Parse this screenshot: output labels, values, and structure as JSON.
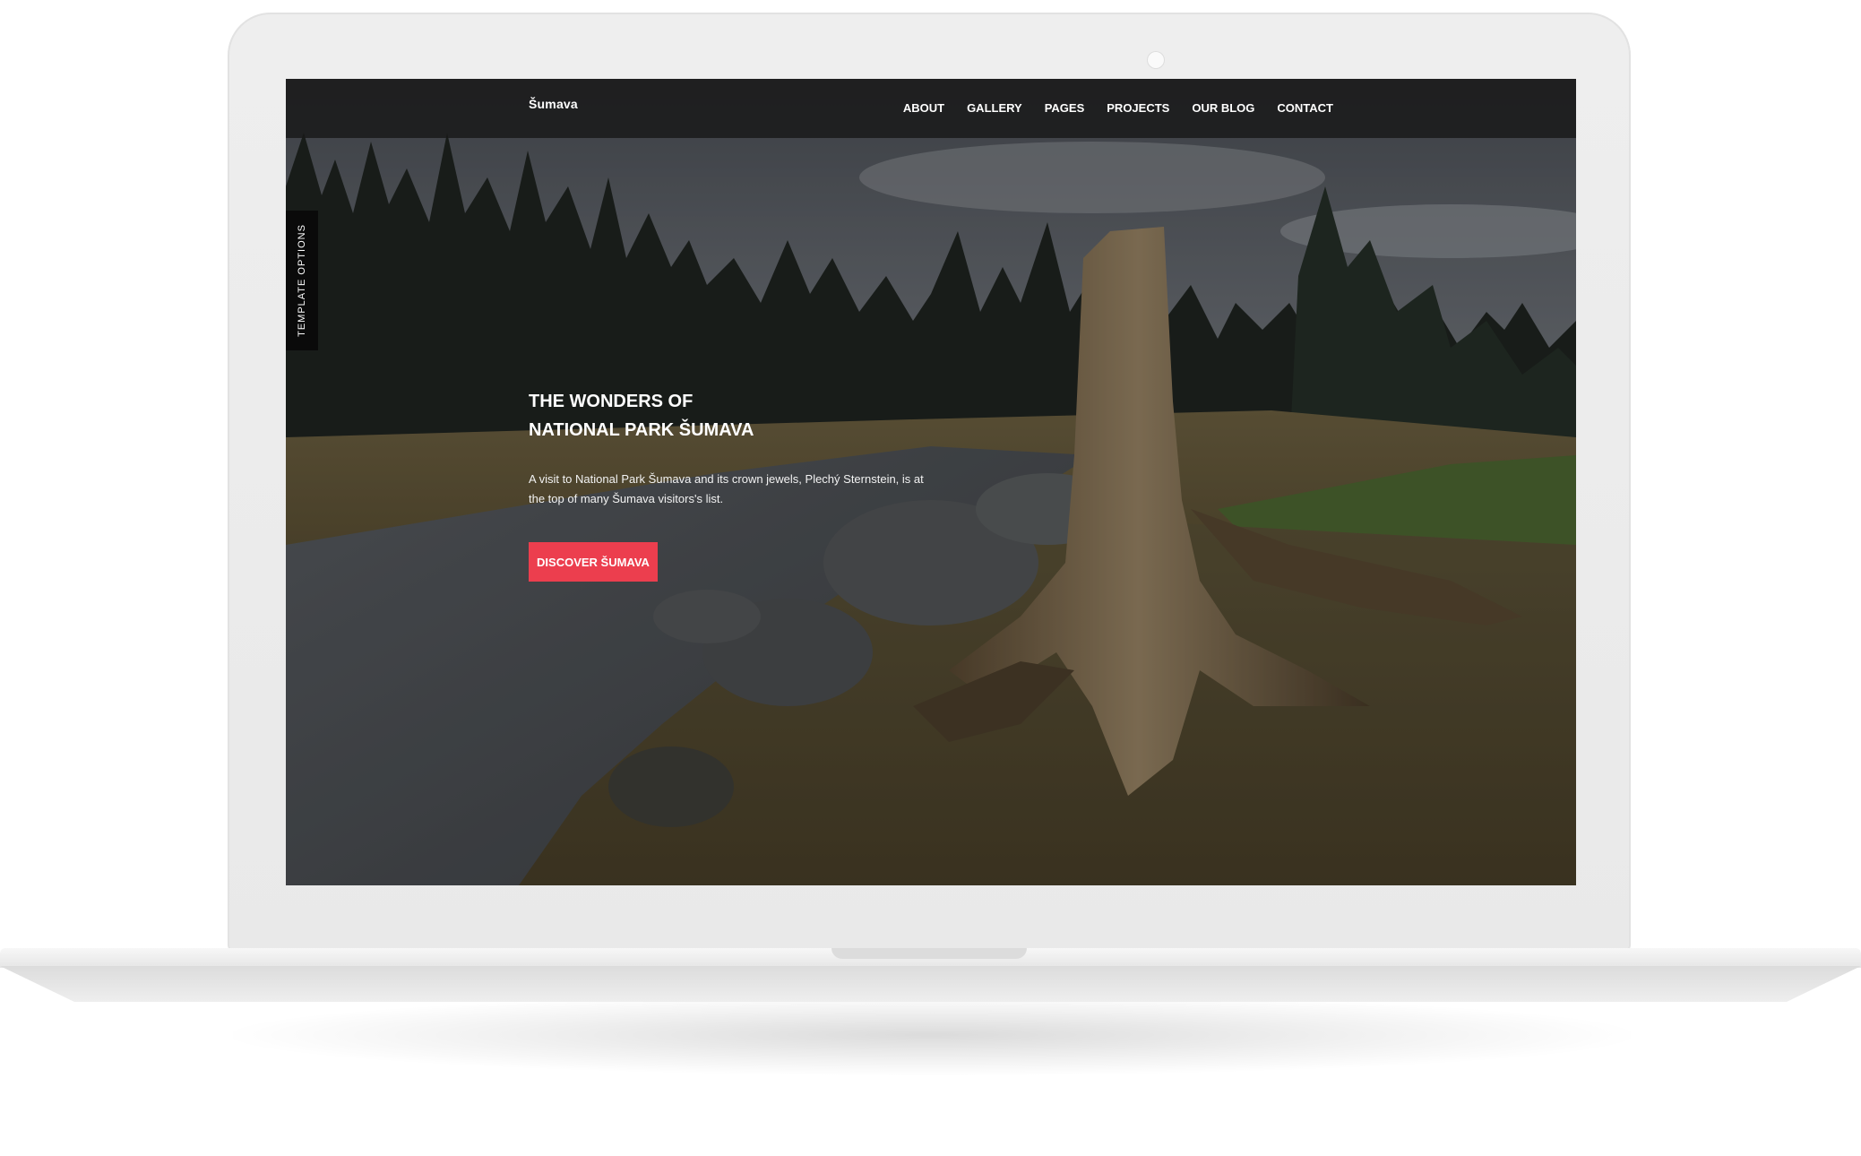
{
  "navbar": {
    "brand": "Šumava",
    "items": [
      "ABOUT",
      "GALLERY",
      "PAGES",
      "PROJECTS",
      "OUR BLOG",
      "CONTACT"
    ]
  },
  "side_tab": {
    "label": "TEMPLATE OPTIONS"
  },
  "hero": {
    "title_line1": "THE WONDERS OF",
    "title_line2": "NATIONAL PARK ŠUMAVA",
    "text": "A visit to National Park Šumava and its crown jewels, Plechý Sternstein, is at the top of many Šumava visitors's list.",
    "button_label": "DISCOVER ŠUMAVA",
    "background": "landscape-photo"
  },
  "colors": {
    "accent": "#ec3e4e",
    "navbar_bg": "#191919",
    "side_tab_bg": "#0a0a0a"
  }
}
